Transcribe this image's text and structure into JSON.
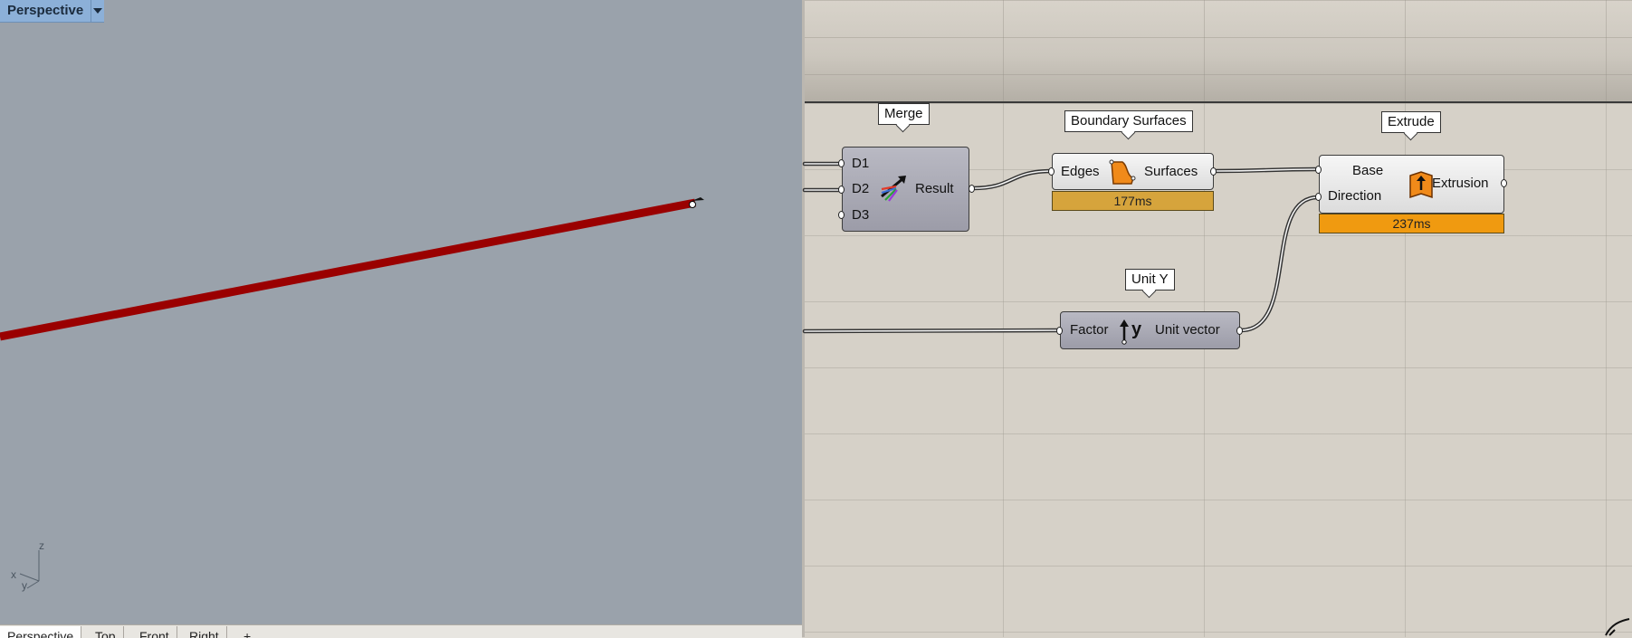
{
  "viewport": {
    "title": "Perspective",
    "axes": {
      "z": "z",
      "x": "x",
      "y": "y"
    },
    "tabs": [
      "Perspective",
      "Top",
      "Front",
      "Right"
    ],
    "curve_color": "#9a0000"
  },
  "canvas": {
    "merge": {
      "tag": "Merge",
      "inputs": [
        "D1",
        "D2",
        "D3"
      ],
      "output": "Result"
    },
    "boundary": {
      "tag": "Boundary Surfaces",
      "input": "Edges",
      "output": "Surfaces",
      "time": "177ms",
      "time_color": "#d6a43c"
    },
    "extrude": {
      "tag": "Extrude",
      "inputs": [
        "Base",
        "Direction"
      ],
      "output": "Extrusion",
      "time": "237ms",
      "time_color": "#f09a10"
    },
    "unity": {
      "tag": "Unit Y",
      "input": "Factor",
      "output": "Unit vector"
    }
  }
}
